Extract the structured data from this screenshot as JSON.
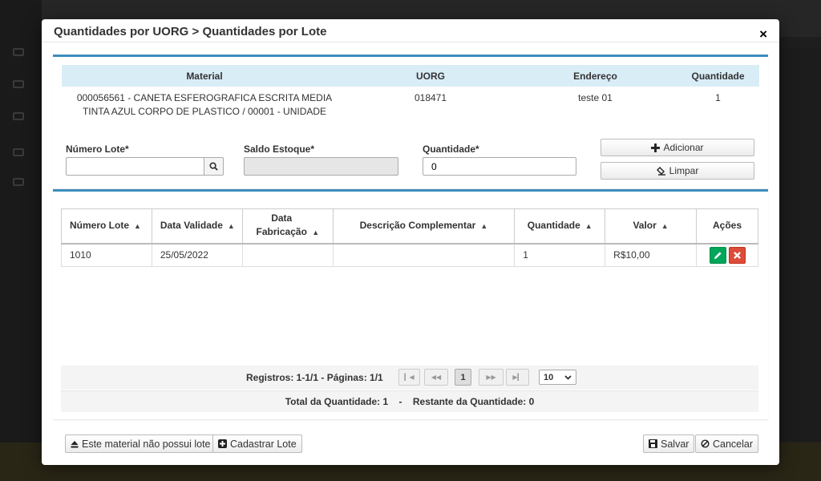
{
  "modal": {
    "title": "Quantidades por UORG > Quantidades por Lote",
    "close_label": "×"
  },
  "material_table": {
    "headers": {
      "material": "Material",
      "uorg": "UORG",
      "endereco": "Endereço",
      "quantidade": "Quantidade"
    },
    "row": {
      "material": "000056561 - CANETA ESFEROGRAFICA ESCRITA MEDIA TINTA AZUL CORPO DE PLASTICO / 00001 - UNIDADE",
      "uorg": "018471",
      "endereco": "teste 01",
      "quantidade": "1"
    }
  },
  "form": {
    "numero_lote_label": "Número Lote*",
    "numero_lote_value": "",
    "saldo_estoque_label": "Saldo Estoque*",
    "saldo_estoque_value": "",
    "quantidade_label": "Quantidade*",
    "quantidade_value": "0",
    "adicionar_label": "Adicionar",
    "limpar_label": "Limpar"
  },
  "lotes_table": {
    "headers": {
      "numero_lote": "Número Lote",
      "data_validade": "Data Validade",
      "data_fabricacao": "Data Fabricação",
      "descricao": "Descrição Complementar",
      "quantidade": "Quantidade",
      "valor": "Valor",
      "acoes": "Ações"
    },
    "rows": [
      {
        "numero_lote": "1010",
        "data_validade": "25/05/2022",
        "data_fabricacao": "",
        "descricao": "",
        "quantidade": "1",
        "valor": "R$10,00"
      }
    ]
  },
  "pagination": {
    "registros": "Registros: 1-1/1 - Páginas: 1/1",
    "current_page": "1",
    "page_size": "10"
  },
  "totals": {
    "total_quantidade": "Total da Quantidade: 1",
    "separator": "-",
    "restante_quantidade": "Restante da Quantidade: 0"
  },
  "footer": {
    "sem_lote_label": "Este material não possui lote",
    "cadastrar_lote_label": "Cadastrar Lote",
    "salvar_label": "Salvar",
    "cancelar_label": "Cancelar"
  },
  "colors": {
    "panel_accent": "#3c8dbc",
    "header_bg": "#d9edf7",
    "edit_green": "#00a65a",
    "delete_red": "#dd4b39"
  }
}
